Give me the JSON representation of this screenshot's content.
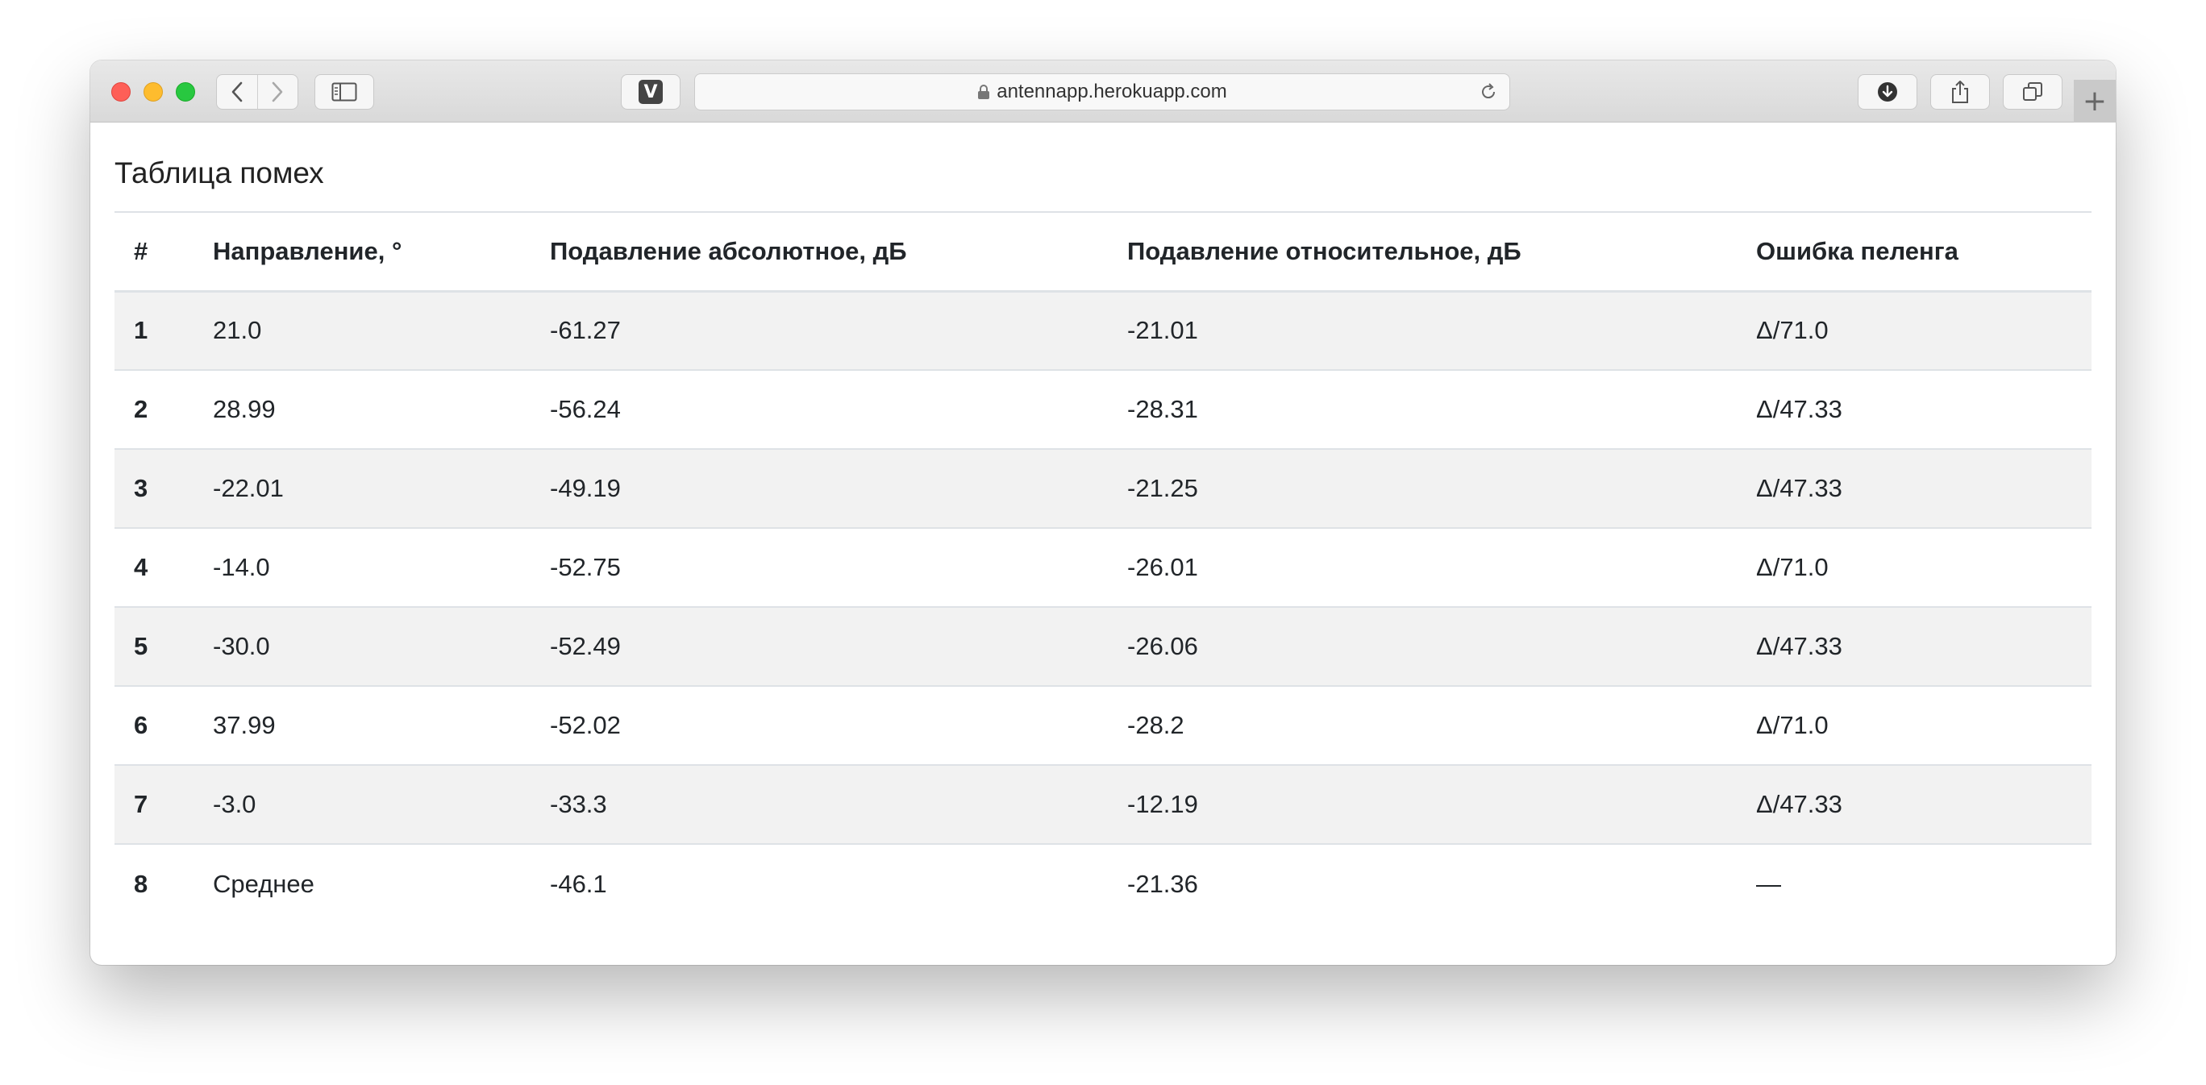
{
  "browser": {
    "url": "antennapp.herokuapp.com",
    "extension_label": "V",
    "new_tab_label": "+"
  },
  "page": {
    "title": "Таблица помех"
  },
  "table": {
    "headers": [
      "#",
      "Направление, °",
      "Подавление абсолютное, дБ",
      "Подавление относительное, дБ",
      "Ошибка пеленга"
    ],
    "rows": [
      [
        "1",
        "21.0",
        "-61.27",
        "-21.01",
        "Δ/71.0"
      ],
      [
        "2",
        "28.99",
        "-56.24",
        "-28.31",
        "Δ/47.33"
      ],
      [
        "3",
        "-22.01",
        "-49.19",
        "-21.25",
        "Δ/47.33"
      ],
      [
        "4",
        "-14.0",
        "-52.75",
        "-26.01",
        "Δ/71.0"
      ],
      [
        "5",
        "-30.0",
        "-52.49",
        "-26.06",
        "Δ/47.33"
      ],
      [
        "6",
        "37.99",
        "-52.02",
        "-28.2",
        "Δ/71.0"
      ],
      [
        "7",
        "-3.0",
        "-33.3",
        "-12.19",
        "Δ/47.33"
      ],
      [
        "8",
        "Среднее",
        "-46.1",
        "-21.36",
        "—"
      ]
    ]
  }
}
